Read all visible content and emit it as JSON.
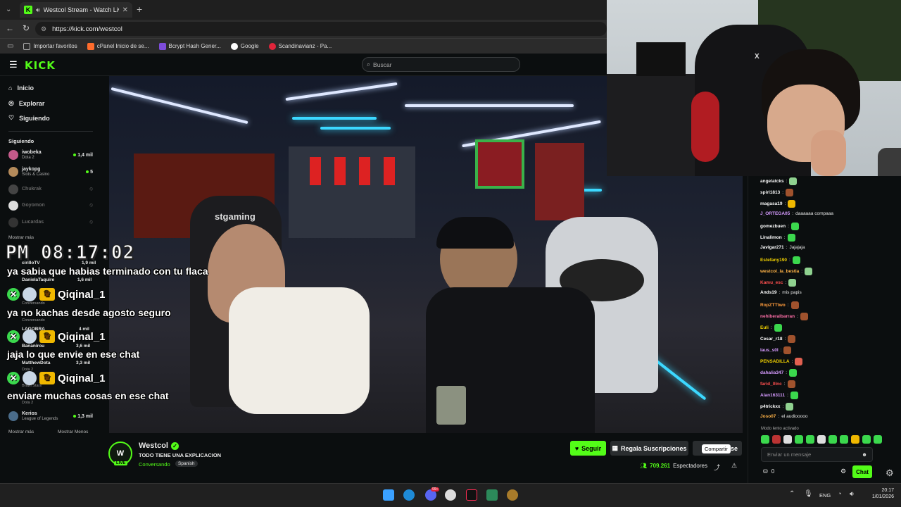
{
  "browser": {
    "tab_title": "Westcol Stream - Watch Live",
    "url": "https://kick.com/westcol",
    "bookmarks": [
      "Importar favoritos",
      "cPanel Inicio de se...",
      "Bcrypt Hash Gener...",
      "Google",
      "Scandinavianz - Pa..."
    ]
  },
  "kick": {
    "logo": "KICK",
    "search_placeholder": "Buscar",
    "nav": [
      "Inicio",
      "Explorar",
      "Siguiendo"
    ],
    "following_title": "Siguiendo",
    "show_more": "Mostrar más",
    "show_less": "Mostrar Menos",
    "channels": [
      {
        "name": "iwobeka",
        "category": "Dota 2",
        "viewers": "1,4 mil"
      },
      {
        "name": "jaykopg",
        "category": "Slots & Casino",
        "viewers": "5"
      },
      {
        "name": "Chukrak",
        "category": "",
        "viewers": ""
      },
      {
        "name": "Goyomon",
        "category": "",
        "viewers": ""
      },
      {
        "name": "Lucardas",
        "category": "",
        "viewers": ""
      }
    ],
    "channels_below": [
      {
        "name": "cirilloTV",
        "viewers": "1,9 mil"
      },
      {
        "name": "DanielaTaquire",
        "viewers": "1,6 mil"
      },
      {
        "name": "LAGOBRA",
        "viewers": "4 mil"
      },
      {
        "name": "Bananirou",
        "viewers": "3,6 mil"
      },
      {
        "name": "MatthewDota",
        "viewers": "3,3 mil"
      },
      {
        "name": "Kerios",
        "category": "League of Legends",
        "viewers": "1,3 mil"
      }
    ],
    "channels_below_misc": [
      "Dota 2",
      "Conversando",
      "Conversando",
      "Dota 2",
      "Brawl Stars",
      "Dota 2"
    ]
  },
  "overlay": {
    "clock": "PM 08:17:02",
    "messages": [
      "ya sabia que habias terminado con tu flaca",
      "ya no kachas desde agosto seguro",
      "jaja lo que envie en ese chat",
      "enviare muchas cosas en ese chat"
    ],
    "username": "Qiqinal_1",
    "badge_glyph": "✕",
    "crown_glyph": "♛"
  },
  "stream": {
    "streamer": "Westcol",
    "title": "TODO TIENE UNA EXPLICACION",
    "category": "Conversando",
    "language": "Spanish",
    "live": "LIVE",
    "follow": "Seguir",
    "gift": "Regala Suscripciones",
    "subscribe_partial": "se",
    "share_tooltip": "Compartir",
    "viewers": "709.261",
    "viewers_label": "Espectadores",
    "video_text": "stgaming"
  },
  "chat": {
    "messages": [
      {
        "user": "angelatcks",
        "text": "",
        "color": "#f5f5f5",
        "emote": "#8fd18f"
      },
      {
        "user": "spirl1813",
        "text": "",
        "color": "#f5f5f5",
        "emote": "#a0522d"
      },
      {
        "user": "magasa19",
        "text": "",
        "color": "#f5f5f5",
        "emote": "#f0b800"
      },
      {
        "user": "J_ORTEGA05",
        "text": "daaaaaa compaaa",
        "color": "#d69bff",
        "emote": ""
      },
      {
        "user": "gomezbuen",
        "text": "",
        "color": "#ffffff",
        "emote": "#3bd84d"
      },
      {
        "user": "Linalimon",
        "text": "",
        "color": "#ffffff",
        "emote": "#3bd84d"
      },
      {
        "user": "Javigar271",
        "text": "Jajajaja",
        "color": "#ffffff",
        "emote": ""
      },
      {
        "user": "Estefany190",
        "text": "",
        "color": "#f0d000",
        "emote": "#3bd84d"
      },
      {
        "user": "westcol_la_bestia",
        "text": "",
        "color": "#ffb347",
        "emote": "#8fd18f"
      },
      {
        "user": "Kamu_esc",
        "text": "",
        "color": "#ff4f4f",
        "emote": "#8fd18f"
      },
      {
        "user": "Ands19",
        "text": "mis papis",
        "color": "#ffffff",
        "emote": ""
      },
      {
        "user": "RopZTTtwo",
        "text": "",
        "color": "#ff9b3b",
        "emote": "#a0522d"
      },
      {
        "user": "nehiberalbarran",
        "text": "",
        "color": "#ff6fa8",
        "emote": "#a0522d"
      },
      {
        "user": "Euli",
        "text": "",
        "color": "#f0d000",
        "emote": "#3bd84d"
      },
      {
        "user": "Cesar_r18",
        "text": "",
        "color": "#ffffff",
        "emote": "#a0522d"
      },
      {
        "user": "laus_s0I",
        "text": "",
        "color": "#d69bff",
        "emote": "#a0522d"
      },
      {
        "user": "PENSADILLA",
        "text": "",
        "color": "#f0d000",
        "emote": "#e06050"
      },
      {
        "user": "dahalia347",
        "text": "",
        "color": "#d69bff",
        "emote": "#3bd84d"
      },
      {
        "user": "farid_0lnc",
        "text": "",
        "color": "#ff4f4f",
        "emote": "#a0522d"
      },
      {
        "user": "Alan163111",
        "text": "",
        "color": "#d69bff",
        "emote": "#3bd84d"
      },
      {
        "user": "p4trickxx",
        "text": "",
        "color": "#ffffff",
        "emote": "#8fd18f"
      },
      {
        "user": "Joso07",
        "text": "el audiooooo",
        "color": "#ffb347",
        "emote": ""
      }
    ],
    "slow_mode": "Modo lento activado",
    "placeholder": "Enviar un mensaje",
    "points": "0",
    "send": "Chat"
  },
  "taskbar": {
    "lang": "ENG",
    "time": "20:17",
    "date": "1/01/2026",
    "badge": "99+"
  },
  "colors": {
    "kick_green": "#53fc18",
    "bg": "#0b0e0f"
  }
}
